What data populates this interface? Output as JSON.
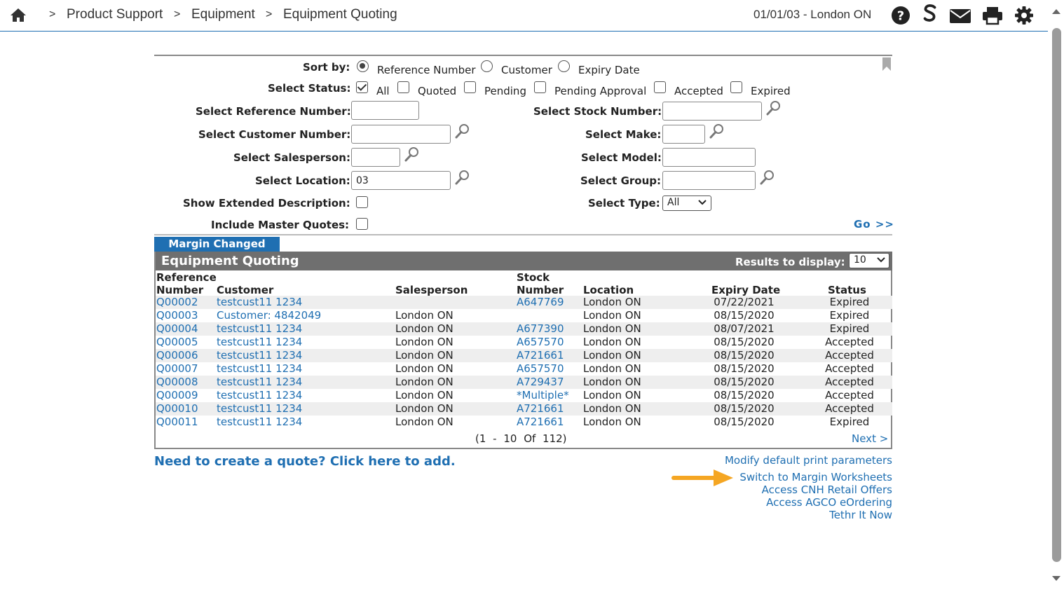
{
  "topbar": {
    "breadcrumb": [
      "Product Support",
      "Equipment",
      "Equipment Quoting"
    ],
    "separator": ">",
    "date_location": "01/01/03 - London ON",
    "icons": [
      "home-icon",
      "help-icon",
      "s-logo-icon",
      "mail-icon",
      "print-icon",
      "settings-icon"
    ]
  },
  "filters": {
    "sort_by": {
      "label": "Sort by:",
      "options": [
        "Reference Number",
        "Customer",
        "Expiry Date"
      ],
      "selected": "Reference Number"
    },
    "status": {
      "label": "Select Status:",
      "options": [
        "All",
        "Quoted",
        "Pending",
        "Pending Approval",
        "Accepted",
        "Expired"
      ],
      "checked": [
        "All"
      ]
    },
    "reference_number": {
      "label": "Select Reference Number:",
      "value": ""
    },
    "customer_number": {
      "label": "Select Customer Number:",
      "value": ""
    },
    "salesperson": {
      "label": "Select Salesperson:",
      "value": ""
    },
    "location": {
      "label": "Select Location:",
      "value": "03"
    },
    "extended_description": {
      "label": "Show Extended Description:",
      "checked": false
    },
    "master_quotes": {
      "label": "Include Master Quotes:",
      "checked": false
    },
    "stock_number": {
      "label": "Select Stock Number:",
      "value": ""
    },
    "make": {
      "label": "Select Make:",
      "value": ""
    },
    "model": {
      "label": "Select Model:",
      "value": ""
    },
    "group": {
      "label": "Select Group:",
      "value": ""
    },
    "type": {
      "label": "Select Type:",
      "value": "All"
    },
    "go_label": "Go >>"
  },
  "tab": {
    "label": "Margin Changed"
  },
  "results": {
    "title": "Equipment Quoting",
    "display_label": "Results to display:",
    "display_value": "10",
    "columns": {
      "reference_top": "Reference",
      "reference_bottom": "Number",
      "customer": "Customer",
      "salesperson": "Salesperson",
      "stock_top": "Stock",
      "stock_bottom": "Number",
      "location": "Location",
      "expiry": "Expiry Date",
      "status": "Status"
    },
    "rows": [
      {
        "ref": "Q00002",
        "customer": "testcust11 1234",
        "salesperson": "",
        "stock": "A647769",
        "location": "London ON",
        "expiry": "07/22/2021",
        "status": "Expired"
      },
      {
        "ref": "Q00003",
        "customer": "Customer: 4842049",
        "salesperson": "London ON",
        "stock": "",
        "location": "London ON",
        "expiry": "08/15/2020",
        "status": "Expired"
      },
      {
        "ref": "Q00004",
        "customer": "testcust11 1234",
        "salesperson": "London ON",
        "stock": "A677390",
        "location": "London ON",
        "expiry": "08/07/2021",
        "status": "Expired"
      },
      {
        "ref": "Q00005",
        "customer": "testcust11 1234",
        "salesperson": "London ON",
        "stock": "A657570",
        "location": "London ON",
        "expiry": "08/15/2020",
        "status": "Accepted"
      },
      {
        "ref": "Q00006",
        "customer": "testcust11 1234",
        "salesperson": "London ON",
        "stock": "A721661",
        "location": "London ON",
        "expiry": "08/15/2020",
        "status": "Accepted"
      },
      {
        "ref": "Q00007",
        "customer": "testcust11 1234",
        "salesperson": "London ON",
        "stock": "A657570",
        "location": "London ON",
        "expiry": "08/15/2020",
        "status": "Accepted"
      },
      {
        "ref": "Q00008",
        "customer": "testcust11 1234",
        "salesperson": "London ON",
        "stock": "A729437",
        "location": "London ON",
        "expiry": "08/15/2020",
        "status": "Accepted"
      },
      {
        "ref": "Q00009",
        "customer": "testcust11 1234",
        "salesperson": "London ON",
        "stock": "*Multiple*",
        "location": "London ON",
        "expiry": "08/15/2020",
        "status": "Accepted"
      },
      {
        "ref": "Q00010",
        "customer": "testcust11 1234",
        "salesperson": "London ON",
        "stock": "A721661",
        "location": "London ON",
        "expiry": "08/15/2020",
        "status": "Accepted"
      },
      {
        "ref": "Q00011",
        "customer": "testcust11 1234",
        "salesperson": "London ON",
        "stock": "A721661",
        "location": "London ON",
        "expiry": "08/15/2020",
        "status": "Expired"
      }
    ],
    "pager": "(1 - 10 Of 112)",
    "next_label": "Next >"
  },
  "links": {
    "create_quote": "Need to create a quote? Click here to add.",
    "modify_print": "Modify default print parameters",
    "switch_margin": "Switch to Margin Worksheets",
    "cnh_offers": "Access CNH Retail Offers",
    "agco_ordering": "Access AGCO eOrdering",
    "tethr": "Tethr It Now"
  },
  "colors": {
    "link": "#1f6fb2",
    "header_bar": "#6f6f6f",
    "tab": "#1f6fb2",
    "arrow": "#f5a623"
  }
}
